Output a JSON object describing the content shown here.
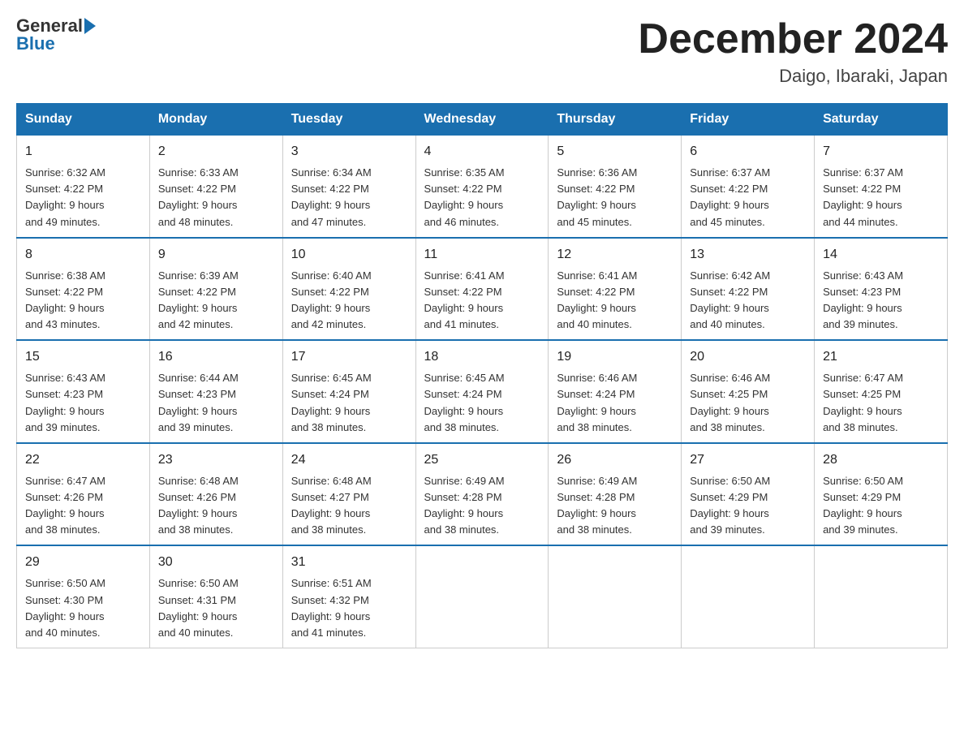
{
  "header": {
    "logo_text_general": "General",
    "logo_text_blue": "Blue",
    "month_year": "December 2024",
    "location": "Daigo, Ibaraki, Japan"
  },
  "days_of_week": [
    "Sunday",
    "Monday",
    "Tuesday",
    "Wednesday",
    "Thursday",
    "Friday",
    "Saturday"
  ],
  "weeks": [
    [
      {
        "day": "1",
        "sunrise": "6:32 AM",
        "sunset": "4:22 PM",
        "daylight": "9 hours and 49 minutes."
      },
      {
        "day": "2",
        "sunrise": "6:33 AM",
        "sunset": "4:22 PM",
        "daylight": "9 hours and 48 minutes."
      },
      {
        "day": "3",
        "sunrise": "6:34 AM",
        "sunset": "4:22 PM",
        "daylight": "9 hours and 47 minutes."
      },
      {
        "day": "4",
        "sunrise": "6:35 AM",
        "sunset": "4:22 PM",
        "daylight": "9 hours and 46 minutes."
      },
      {
        "day": "5",
        "sunrise": "6:36 AM",
        "sunset": "4:22 PM",
        "daylight": "9 hours and 45 minutes."
      },
      {
        "day": "6",
        "sunrise": "6:37 AM",
        "sunset": "4:22 PM",
        "daylight": "9 hours and 45 minutes."
      },
      {
        "day": "7",
        "sunrise": "6:37 AM",
        "sunset": "4:22 PM",
        "daylight": "9 hours and 44 minutes."
      }
    ],
    [
      {
        "day": "8",
        "sunrise": "6:38 AM",
        "sunset": "4:22 PM",
        "daylight": "9 hours and 43 minutes."
      },
      {
        "day": "9",
        "sunrise": "6:39 AM",
        "sunset": "4:22 PM",
        "daylight": "9 hours and 42 minutes."
      },
      {
        "day": "10",
        "sunrise": "6:40 AM",
        "sunset": "4:22 PM",
        "daylight": "9 hours and 42 minutes."
      },
      {
        "day": "11",
        "sunrise": "6:41 AM",
        "sunset": "4:22 PM",
        "daylight": "9 hours and 41 minutes."
      },
      {
        "day": "12",
        "sunrise": "6:41 AM",
        "sunset": "4:22 PM",
        "daylight": "9 hours and 40 minutes."
      },
      {
        "day": "13",
        "sunrise": "6:42 AM",
        "sunset": "4:22 PM",
        "daylight": "9 hours and 40 minutes."
      },
      {
        "day": "14",
        "sunrise": "6:43 AM",
        "sunset": "4:23 PM",
        "daylight": "9 hours and 39 minutes."
      }
    ],
    [
      {
        "day": "15",
        "sunrise": "6:43 AM",
        "sunset": "4:23 PM",
        "daylight": "9 hours and 39 minutes."
      },
      {
        "day": "16",
        "sunrise": "6:44 AM",
        "sunset": "4:23 PM",
        "daylight": "9 hours and 39 minutes."
      },
      {
        "day": "17",
        "sunrise": "6:45 AM",
        "sunset": "4:24 PM",
        "daylight": "9 hours and 38 minutes."
      },
      {
        "day": "18",
        "sunrise": "6:45 AM",
        "sunset": "4:24 PM",
        "daylight": "9 hours and 38 minutes."
      },
      {
        "day": "19",
        "sunrise": "6:46 AM",
        "sunset": "4:24 PM",
        "daylight": "9 hours and 38 minutes."
      },
      {
        "day": "20",
        "sunrise": "6:46 AM",
        "sunset": "4:25 PM",
        "daylight": "9 hours and 38 minutes."
      },
      {
        "day": "21",
        "sunrise": "6:47 AM",
        "sunset": "4:25 PM",
        "daylight": "9 hours and 38 minutes."
      }
    ],
    [
      {
        "day": "22",
        "sunrise": "6:47 AM",
        "sunset": "4:26 PM",
        "daylight": "9 hours and 38 minutes."
      },
      {
        "day": "23",
        "sunrise": "6:48 AM",
        "sunset": "4:26 PM",
        "daylight": "9 hours and 38 minutes."
      },
      {
        "day": "24",
        "sunrise": "6:48 AM",
        "sunset": "4:27 PM",
        "daylight": "9 hours and 38 minutes."
      },
      {
        "day": "25",
        "sunrise": "6:49 AM",
        "sunset": "4:28 PM",
        "daylight": "9 hours and 38 minutes."
      },
      {
        "day": "26",
        "sunrise": "6:49 AM",
        "sunset": "4:28 PM",
        "daylight": "9 hours and 38 minutes."
      },
      {
        "day": "27",
        "sunrise": "6:50 AM",
        "sunset": "4:29 PM",
        "daylight": "9 hours and 39 minutes."
      },
      {
        "day": "28",
        "sunrise": "6:50 AM",
        "sunset": "4:29 PM",
        "daylight": "9 hours and 39 minutes."
      }
    ],
    [
      {
        "day": "29",
        "sunrise": "6:50 AM",
        "sunset": "4:30 PM",
        "daylight": "9 hours and 40 minutes."
      },
      {
        "day": "30",
        "sunrise": "6:50 AM",
        "sunset": "4:31 PM",
        "daylight": "9 hours and 40 minutes."
      },
      {
        "day": "31",
        "sunrise": "6:51 AM",
        "sunset": "4:32 PM",
        "daylight": "9 hours and 41 minutes."
      },
      null,
      null,
      null,
      null
    ]
  ],
  "labels": {
    "sunrise": "Sunrise:",
    "sunset": "Sunset:",
    "daylight": "Daylight:"
  }
}
